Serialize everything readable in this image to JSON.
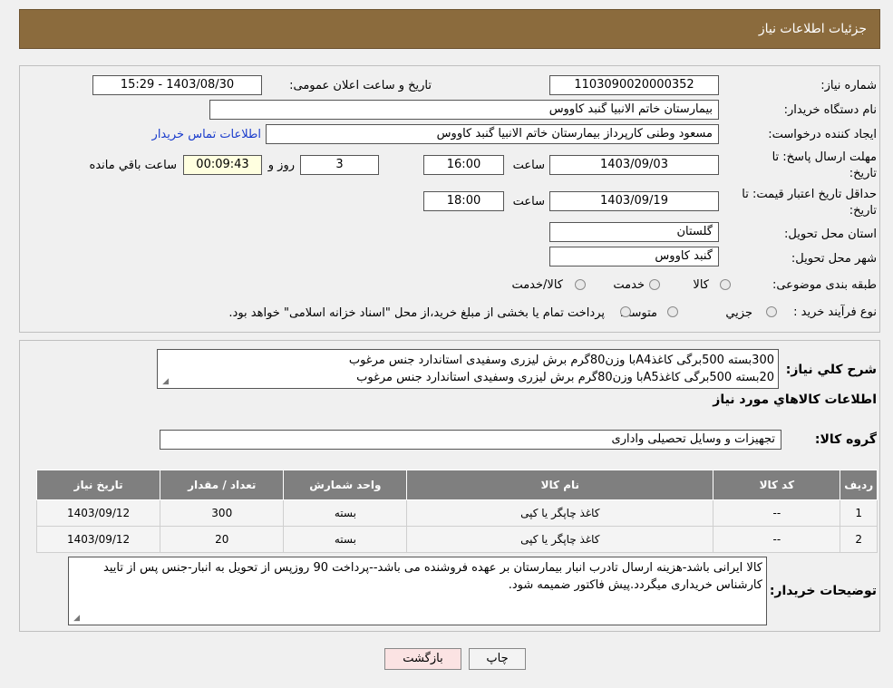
{
  "header": {
    "title": "جزئیات اطلاعات نیاز"
  },
  "form": {
    "need_number_label": "شماره نیاز:",
    "need_number": "1103090020000352",
    "announce_label": "تاریخ و ساعت اعلان عمومی:",
    "announce_value": "1403/08/30 - 15:29",
    "buyer_org_label": "نام دستگاه خریدار:",
    "buyer_org": "بیمارستان خاتم الانبیا گنبد کاووس",
    "creator_label": "ایجاد کننده درخواست:",
    "creator": "مسعود وطنی کارپرداز بیمارستان خاتم الانبیا گنبد کاووس",
    "contact_link": "اطلاعات تماس خریدار",
    "deadline_label_1": "مهلت ارسال پاسخ: تا",
    "deadline_label_2": "تاریخ:",
    "deadline_date": "1403/09/03",
    "time_word": "ساعت",
    "deadline_time": "16:00",
    "remain_days": "3",
    "days_word": "روز و",
    "remain_time": "00:09:43",
    "remain_word": "ساعت باقي مانده",
    "validity_label_1": "حداقل تاریخ اعتبار قیمت: تا",
    "validity_label_2": "تاریخ:",
    "validity_date": "1403/09/19",
    "validity_time": "18:00",
    "province_label": "استان محل تحویل:",
    "province": "گلستان",
    "city_label": "شهر محل تحویل:",
    "city": "گنبد کاووس",
    "category_label": "طبقه بندی موضوعی:",
    "category_options": [
      "کالا",
      "خدمت",
      "کالا/خدمت"
    ],
    "process_label": "نوع فرآیند خرید :",
    "process_options": [
      "جزيي",
      "متوسط"
    ],
    "process_note": "پرداخت تمام یا بخشی از مبلغ خرید،از محل \"اسناد خزانه اسلامی\" خواهد بود."
  },
  "summary": {
    "label": "شرح كلي نياز:",
    "line1": "300بسته 500برگی کاغذA4با وزن80گرم برش لیزری وسفیدی استاندارد جنس مرغوب",
    "line2": "20بسته 500برگی کاغذA5با وزن80گرم برش لیزری وسفیدی استاندارد جنس مرغوب",
    "items_title": "اطلاعات كالاهاي مورد نياز",
    "group_label": "گروه كالا:",
    "group_value": "تجهیزات و وسایل تحصیلی واداری"
  },
  "table": {
    "headers": [
      "رديف",
      "کد کالا",
      "نام کالا",
      "واحد شمارش",
      "تعداد / مقدار",
      "تاريخ نياز"
    ],
    "rows": [
      [
        "1",
        "--",
        "کاغذ چاپگر یا کپی",
        "بسته",
        "300",
        "1403/09/12"
      ],
      [
        "2",
        "--",
        "کاغذ چاپگر یا کپی",
        "بسته",
        "20",
        "1403/09/12"
      ]
    ]
  },
  "buyer_notes": {
    "label": "توضیحات خریدار:",
    "text": "کالا ایرانی باشد-هزینه ارسال تادرب انبار بیمارستان بر عهده فروشنده می باشد--پرداخت 90 روزپس از تحویل به انبار-جنس پس از تایید کارشناس خریداری میگردد.پیش فاکتور ضمیمه شود."
  },
  "buttons": {
    "print": "چاپ",
    "back": "بازگشت"
  },
  "colors": {
    "header": "#8b6b3d",
    "table_header": "#7f7f7f",
    "link": "#1a3ccc",
    "back_button": "#fbe3e3"
  }
}
